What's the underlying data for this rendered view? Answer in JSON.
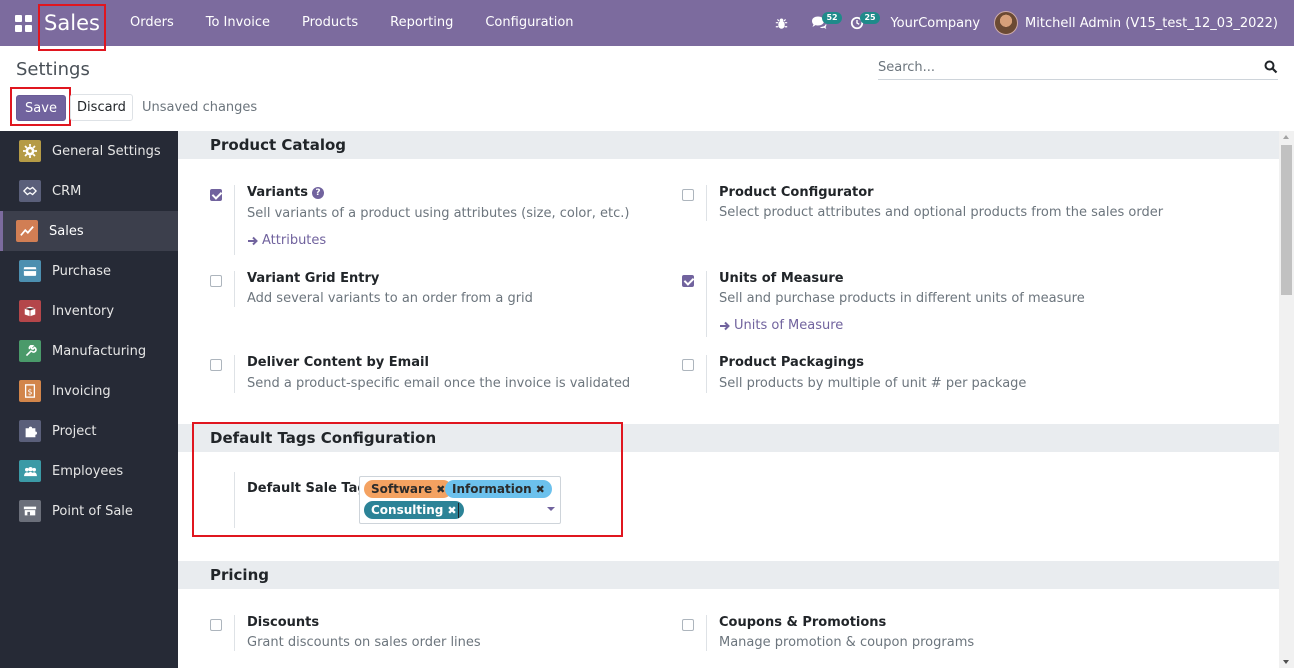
{
  "navbar": {
    "app_name": "Sales",
    "menu": [
      "Orders",
      "To Invoice",
      "Products",
      "Reporting",
      "Configuration"
    ],
    "messages_count": "52",
    "activities_count": "25",
    "company": "YourCompany",
    "user": "Mitchell Admin (V15_test_12_03_2022)",
    "color": "#7c6b9e"
  },
  "control_panel": {
    "title": "Settings",
    "search_placeholder": "Search...",
    "save_label": "Save",
    "discard_label": "Discard",
    "status": "Unsaved changes"
  },
  "sidebar": {
    "items": [
      {
        "label": "General Settings",
        "icon": "gear-icon",
        "color": "#b59b46"
      },
      {
        "label": "CRM",
        "icon": "crm-icon",
        "color": "#5a5f7a"
      },
      {
        "label": "Sales",
        "icon": "sales-chart-icon",
        "color": "#d17e54",
        "active": true
      },
      {
        "label": "Purchase",
        "icon": "purchase-card-icon",
        "color": "#4c8fb0"
      },
      {
        "label": "Inventory",
        "icon": "inventory-box-icon",
        "color": "#b4464a"
      },
      {
        "label": "Manufacturing",
        "icon": "wrench-icon",
        "color": "#4a9a6a"
      },
      {
        "label": "Invoicing",
        "icon": "invoice-dollar-icon",
        "color": "#d2854a"
      },
      {
        "label": "Project",
        "icon": "puzzle-icon",
        "color": "#5a5f7a"
      },
      {
        "label": "Employees",
        "icon": "people-icon",
        "color": "#3b9aa6"
      },
      {
        "label": "Point of Sale",
        "icon": "store-icon",
        "color": "#6b6f7a"
      }
    ]
  },
  "sections": {
    "product_catalog": {
      "title": "Product Catalog",
      "settings": [
        {
          "title": "Variants",
          "desc": "Sell variants of a product using attributes (size, color, etc.)",
          "link": "Attributes",
          "checked": true
        },
        {
          "title": "Product Configurator",
          "desc": "Select product attributes and optional products from the sales order",
          "checked": false
        },
        {
          "title": "Variant Grid Entry",
          "desc": "Add several variants to an order from a grid",
          "checked": false
        },
        {
          "title": "Units of Measure",
          "desc": "Sell and purchase products in different units of measure",
          "link": "Units of Measure",
          "checked": true
        },
        {
          "title": "Deliver Content by Email",
          "desc": "Send a product-specific email once the invoice is validated",
          "checked": false
        },
        {
          "title": "Product Packagings",
          "desc": "Sell products by multiple of unit # per package",
          "checked": false
        }
      ]
    },
    "default_tags": {
      "title": "Default Tags Configuration",
      "field_label": "Default Sale Tags",
      "tags": [
        {
          "label": "Software",
          "color": "#f4a261"
        },
        {
          "label": "Information",
          "color": "#6cc1ed"
        },
        {
          "label": "Consulting",
          "color": "#2c8397"
        }
      ]
    },
    "pricing": {
      "title": "Pricing",
      "settings": [
        {
          "title": "Discounts",
          "desc": "Grant discounts on sales order lines",
          "checked": false
        },
        {
          "title": "Coupons & Promotions",
          "desc": "Manage promotion & coupon programs",
          "checked": false
        }
      ]
    }
  }
}
